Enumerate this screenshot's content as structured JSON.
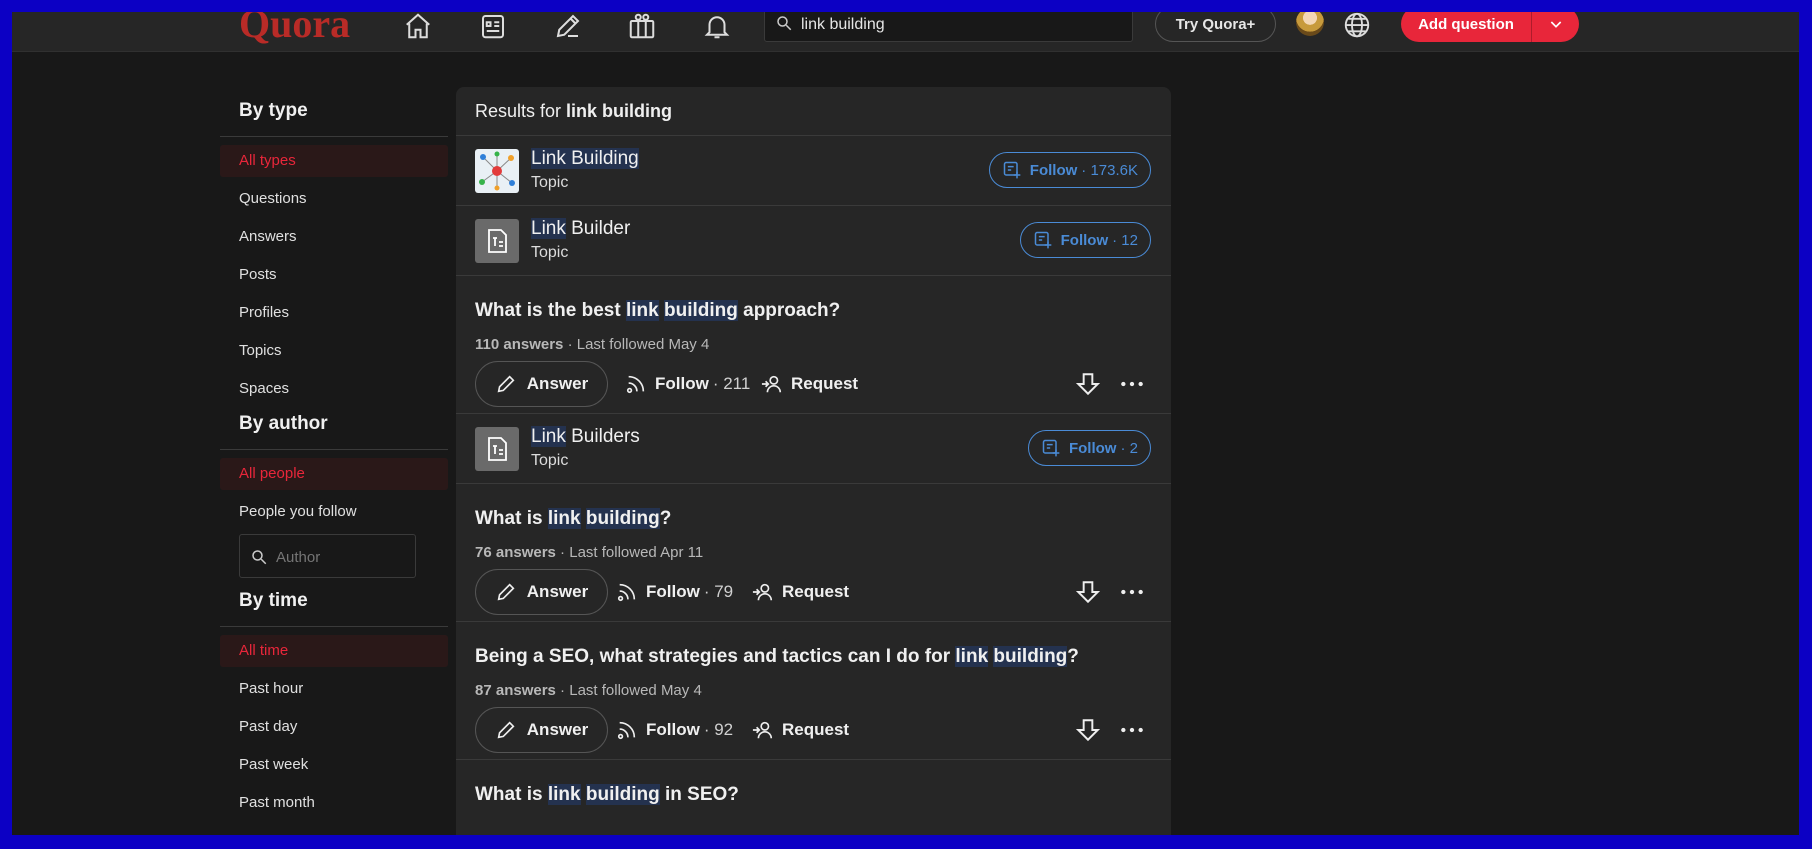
{
  "header": {
    "logo": "Quora",
    "search_value": "link building",
    "try_label": "Try Quora+",
    "add_question_label": "Add question"
  },
  "sidebar": {
    "by_type": {
      "heading": "By type",
      "items": [
        "All types",
        "Questions",
        "Answers",
        "Posts",
        "Profiles",
        "Topics",
        "Spaces"
      ]
    },
    "by_author": {
      "heading": "By author",
      "items": [
        "All people",
        "People you follow"
      ],
      "author_placeholder": "Author"
    },
    "by_time": {
      "heading": "By time",
      "items": [
        "All time",
        "Past hour",
        "Past day",
        "Past week",
        "Past month"
      ]
    }
  },
  "results": {
    "prefix": "Results for",
    "query": "link building",
    "topics": [
      {
        "name_hl": "Link Building",
        "name_rest": "",
        "type": "Topic",
        "follow": "Follow",
        "count": "· 173.6K"
      },
      {
        "name_hl": "Link",
        "name_rest": " Builder",
        "type": "Topic",
        "follow": "Follow",
        "count": "· 12"
      },
      {
        "name_hl": "Link",
        "name_rest": " Builders",
        "type": "Topic",
        "follow": "Follow",
        "count": "· 2"
      }
    ],
    "questions": [
      {
        "t1": "What is the best ",
        "h1": "link",
        "t2": " ",
        "h2": "building",
        "t3": " approach?",
        "answers": "110 answers",
        "followed": " · Last followed May 4",
        "follow_count": "· 211"
      },
      {
        "t1": "What is ",
        "h1": "link",
        "t2": " ",
        "h2": "building",
        "t3": "?",
        "answers": "76 answers",
        "followed": " · Last followed Apr 11",
        "follow_count": "· 79"
      },
      {
        "t1": "Being a SEO, what strategies and tactics can I do for ",
        "h1": "link",
        "t2": " ",
        "h2": "building",
        "t3": "?",
        "answers": "87 answers",
        "followed": " · Last followed May 4",
        "follow_count": "· 92"
      },
      {
        "t1": "What is ",
        "h1": "link",
        "t2": " ",
        "h2": "building",
        "t3": " in SEO?"
      }
    ],
    "answer_label": "Answer",
    "follow_label": "Follow",
    "request_label": "Request"
  },
  "colors": {
    "accent": "#e8263a",
    "follow_blue": "#4a8bd6",
    "logo": "#b92b27"
  }
}
